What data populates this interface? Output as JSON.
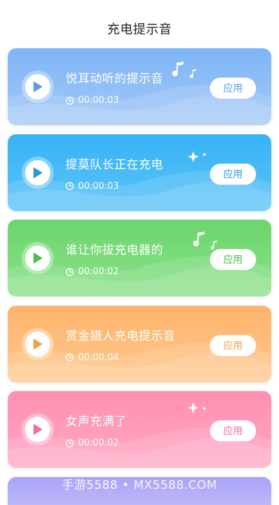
{
  "header": {
    "title": "充电提示音"
  },
  "tones": [
    {
      "name": "悦耳动听的提示音",
      "duration": "00:00:03",
      "apply_label": "应用",
      "gradient": [
        "#7EB5F5",
        "#A3C8F7"
      ],
      "accent": "#5E9BE9",
      "decoration": "music-notes"
    },
    {
      "name": "提莫队长正在充电",
      "duration": "00:00:03",
      "apply_label": "应用",
      "gradient": [
        "#37B2F5",
        "#5CC4F9"
      ],
      "accent": "#2A98DF",
      "decoration": "sparkles"
    },
    {
      "name": "谁让你拔充电器的",
      "duration": "00:00:02",
      "apply_label": "应用",
      "gradient": [
        "#6BD66B",
        "#8BE18B"
      ],
      "accent": "#4CBB4C",
      "decoration": "music-notes"
    },
    {
      "name": "赏金猎人充电提示音",
      "duration": "00:00:04",
      "apply_label": "应用",
      "gradient": [
        "#FDB36B",
        "#FEC98F"
      ],
      "accent": "#F3A04A",
      "decoration": "none"
    },
    {
      "name": "女声充满了",
      "duration": "00:00:02",
      "apply_label": "应用",
      "gradient": [
        "#FF8FB0",
        "#FFA9C4"
      ],
      "accent": "#F26E96",
      "decoration": "sparkles"
    }
  ],
  "partial_card": {
    "gradient": [
      "#A9A3F7",
      "#BDB8FA"
    ]
  },
  "watermark": "手游5588 • MX5588.COM",
  "icons": {
    "play": "play-icon",
    "clock": "clock-icon"
  }
}
